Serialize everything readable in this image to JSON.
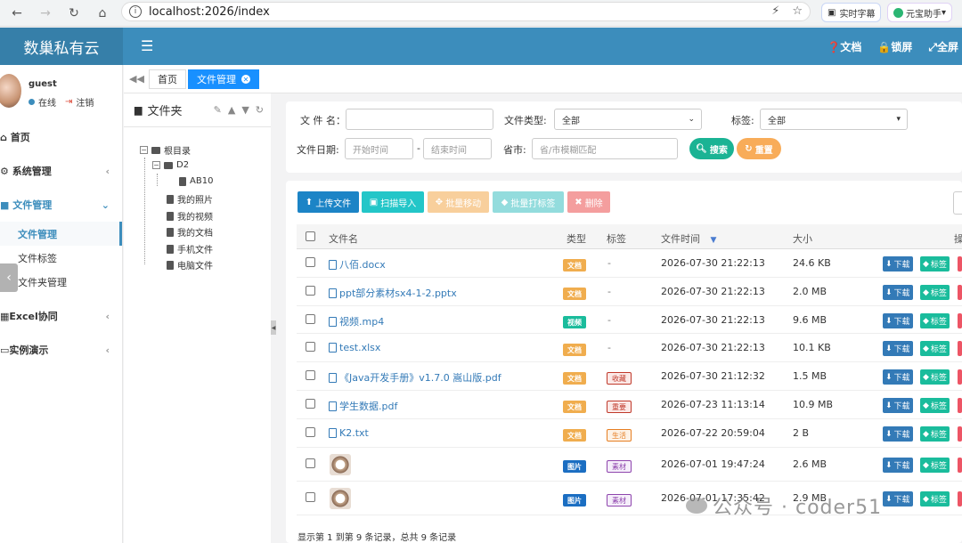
{
  "browser": {
    "url": "localhost:2026/index",
    "ext1": "实时字幕",
    "ext2": "元宝助手",
    "ext2_caret": "▾"
  },
  "header": {
    "brand": "数巢私有云",
    "docs": "文档",
    "lock": "锁屏",
    "fullscreen": "全屏"
  },
  "sidebar": {
    "username": "guest",
    "status": "在线",
    "logout": "注销",
    "items": [
      {
        "label": "首页"
      },
      {
        "label": "系统管理"
      },
      {
        "label": "文件管理",
        "active": true
      },
      {
        "label": "Excel协同"
      },
      {
        "label": "实例演示"
      }
    ],
    "subitems": [
      {
        "label": "文件管理",
        "active": true
      },
      {
        "label": "文件标签"
      },
      {
        "label": "文件夹管理"
      }
    ]
  },
  "tabs": {
    "home": "首页",
    "current": "文件管理"
  },
  "folder_tree": {
    "title": "文件夹",
    "root": "根目录",
    "d2": "D2",
    "ab10": "AB10",
    "folders": [
      "我的照片",
      "我的视频",
      "我的文档",
      "手机文件",
      "电脑文件"
    ]
  },
  "search": {
    "name_label": "文 件 名：",
    "type_label": "文件类型:",
    "type_value": "全部",
    "tag_label": "标签:",
    "tag_value": "全部",
    "date_label": "文件日期:",
    "start_placeholder": "开始时间",
    "end_placeholder": "结束时间",
    "date_sep": "-",
    "city_label": "省市:",
    "city_placeholder": "省/市模糊匹配",
    "search_btn": "搜索",
    "reset_btn": "重置"
  },
  "toolbar": {
    "upload": "上传文件",
    "scan": "扫描导入",
    "batch_move": "批量移动",
    "batch_tag": "批量打标签",
    "delete": "删除"
  },
  "table": {
    "headers": {
      "name": "文件名",
      "type": "类型",
      "tag": "标签",
      "time": "文件时间",
      "size": "大小",
      "ops": "操"
    },
    "download": "下载",
    "tag_btn": "标签",
    "rows": [
      {
        "name": "八佰.docx",
        "type": "文档",
        "tag": "-",
        "time": "2026-07-30 21:22:13",
        "size": "24.6 KB"
      },
      {
        "name": "ppt部分素材sx4-1-2.pptx",
        "type": "文档",
        "tag": "-",
        "time": "2026-07-30 21:22:13",
        "size": "2.0 MB"
      },
      {
        "name": "视频.mp4",
        "type": "视频",
        "tag": "-",
        "time": "2026-07-30 21:22:13",
        "size": "9.6 MB"
      },
      {
        "name": "test.xlsx",
        "type": "文档",
        "tag": "-",
        "time": "2026-07-30 21:22:13",
        "size": "10.1 KB"
      },
      {
        "name": "《Java开发手册》v1.7.0 嵩山版.pdf",
        "type": "文档",
        "tag": "收藏",
        "time": "2026-07-30 21:12:32",
        "size": "1.5 MB"
      },
      {
        "name": "学生数据.pdf",
        "type": "文档",
        "tag": "重要",
        "time": "2026-07-23 11:13:14",
        "size": "10.9 MB"
      },
      {
        "name": "K2.txt",
        "type": "文档",
        "tag": "生活",
        "time": "2026-07-22 20:59:04",
        "size": "2 B"
      },
      {
        "name": "",
        "type": "图片",
        "tag": "素材",
        "time": "2026-07-01 19:47:24",
        "size": "2.6 MB"
      },
      {
        "name": "",
        "type": "图片",
        "tag": "素材",
        "time": "2026-07-01 17:35:42",
        "size": "2.9 MB"
      }
    ]
  },
  "footer": "显示第 1 到第 9 条记录，总共 9 条记录",
  "watermark": "公众号 · coder51",
  "colors": {
    "header": "#3c8dbc",
    "doc_badge": "#f0ad4e",
    "video_badge": "#1abc9c",
    "image_badge": "#1b6ec2",
    "download": "#337ab7",
    "tag_btn": "#1abc9c"
  }
}
